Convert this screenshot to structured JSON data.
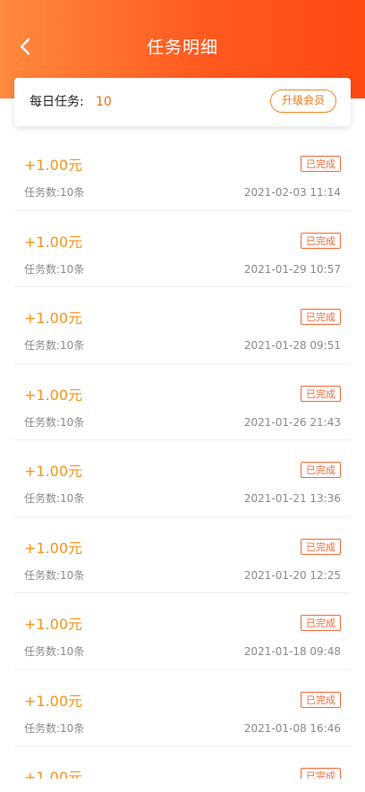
{
  "header": {
    "title": "任务明细",
    "back_icon": "chevron-left-icon"
  },
  "summary": {
    "label": "每日任务:",
    "value": "10",
    "upgrade_label": "升级会员"
  },
  "colors": {
    "accent": "#ff5a1f",
    "amount": "#f7931a",
    "badge": "#f26a3a"
  },
  "items": [
    {
      "amount": "+1.00元",
      "status": "已完成",
      "count": "任务数:10条",
      "time": "2021-02-03 11:14"
    },
    {
      "amount": "+1.00元",
      "status": "已完成",
      "count": "任务数:10条",
      "time": "2021-01-29 10:57"
    },
    {
      "amount": "+1.00元",
      "status": "已完成",
      "count": "任务数:10条",
      "time": "2021-01-28 09:51"
    },
    {
      "amount": "+1.00元",
      "status": "已完成",
      "count": "任务数:10条",
      "time": "2021-01-26 21:43"
    },
    {
      "amount": "+1.00元",
      "status": "已完成",
      "count": "任务数:10条",
      "time": "2021-01-21 13:36"
    },
    {
      "amount": "+1.00元",
      "status": "已完成",
      "count": "任务数:10条",
      "time": "2021-01-20 12:25"
    },
    {
      "amount": "+1.00元",
      "status": "已完成",
      "count": "任务数:10条",
      "time": "2021-01-18 09:48"
    },
    {
      "amount": "+1.00元",
      "status": "已完成",
      "count": "任务数:10条",
      "time": "2021-01-08 16:46"
    },
    {
      "amount": "+1.00元",
      "status": "已完成",
      "count": "",
      "time": ""
    }
  ]
}
